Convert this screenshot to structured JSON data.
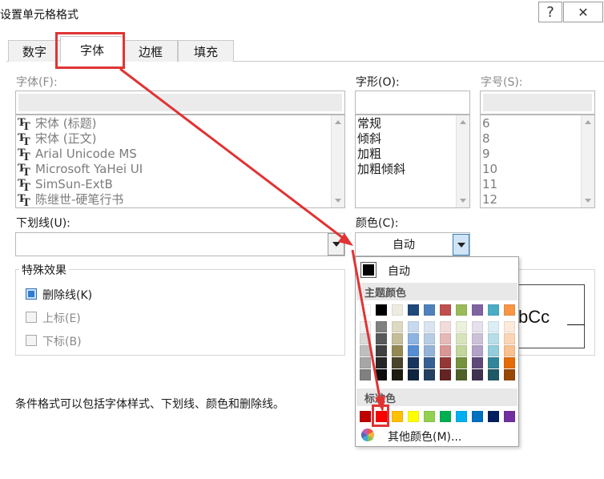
{
  "window": {
    "title": "设置单元格格式",
    "help_glyph": "?",
    "close_glyph": "✕"
  },
  "tabs": [
    {
      "label": "数字",
      "active": false
    },
    {
      "label": "字体",
      "active": true
    },
    {
      "label": "边框",
      "active": false
    },
    {
      "label": "填充",
      "active": false
    }
  ],
  "font": {
    "label": "字体(F):",
    "value": "",
    "items": [
      "宋体 (标题)",
      "宋体 (正文)",
      "Arial Unicode MS",
      "Microsoft YaHei UI",
      "SimSun-ExtB",
      "陈继世-硬笔行书"
    ]
  },
  "style": {
    "label": "字形(O):",
    "value": "",
    "items": [
      "常规",
      "倾斜",
      "加粗",
      "加粗倾斜"
    ]
  },
  "size": {
    "label": "字号(S):",
    "value": "",
    "items": [
      "6",
      "8",
      "9",
      "10",
      "11",
      "12"
    ]
  },
  "underline": {
    "label": "下划线(U):",
    "value": ""
  },
  "color": {
    "label": "颜色(C):",
    "value": "自动"
  },
  "effects": {
    "legend": "特殊效果",
    "strikethrough": {
      "label": "删除线(K)",
      "checked": true
    },
    "superscript": {
      "label": "上标(E)",
      "checked": false
    },
    "subscript": {
      "label": "下标(B)",
      "checked": false
    }
  },
  "preview_text": "bCc",
  "note": "条件格式可以包括字体样式、下划线、颜色和删除线。",
  "palette": {
    "auto_label": "自动",
    "theme_label": "主题颜色",
    "standard_label": "标准色",
    "more_label": "其他颜色(M)...",
    "auto_color": "#000000",
    "theme_columns": [
      [
        "#ffffff",
        "#f2f2f2",
        "#d9d9d9",
        "#bfbfbf",
        "#a6a6a6",
        "#808080"
      ],
      [
        "#000000",
        "#808080",
        "#595959",
        "#404040",
        "#262626",
        "#0d0d0d"
      ],
      [
        "#eeece1",
        "#ddd9c3",
        "#c4bd97",
        "#938953",
        "#494429",
        "#1d1b10"
      ],
      [
        "#1f497d",
        "#c6d9f0",
        "#8db3e2",
        "#548dd4",
        "#17365d",
        "#0f243e"
      ],
      [
        "#4f81bd",
        "#dbe5f1",
        "#b8cce4",
        "#95b3d7",
        "#366092",
        "#244061"
      ],
      [
        "#c0504d",
        "#f2dcdb",
        "#e5b9b7",
        "#d99694",
        "#953734",
        "#632423"
      ],
      [
        "#9bbb59",
        "#ebf1dd",
        "#d7e3bc",
        "#c3d69b",
        "#76923c",
        "#4f6128"
      ],
      [
        "#8064a2",
        "#e5e0ec",
        "#ccc1d9",
        "#b2a2c7",
        "#5f497a",
        "#3f3151"
      ],
      [
        "#4bacc6",
        "#dbeef3",
        "#b7dde8",
        "#92cddc",
        "#31859b",
        "#205867"
      ],
      [
        "#f79646",
        "#fdeada",
        "#fbd5b5",
        "#fac08f",
        "#e36c09",
        "#974806"
      ]
    ],
    "standard_colors": [
      "#c00000",
      "#ff0000",
      "#ffc000",
      "#ffff00",
      "#92d050",
      "#00b050",
      "#00b0f0",
      "#0070c0",
      "#002060",
      "#7030a0"
    ],
    "selected_standard_index": 1
  },
  "accent_red": "#e03434"
}
